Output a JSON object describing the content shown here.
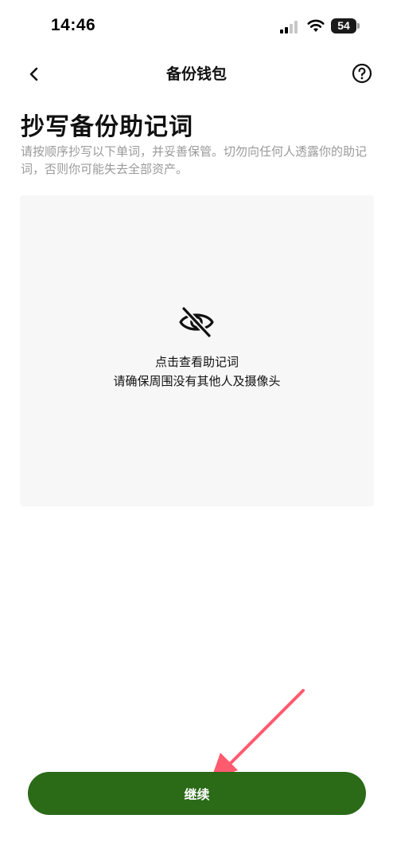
{
  "status_bar": {
    "time": "14:46",
    "battery": "54",
    "icons": [
      "signal-icon",
      "wifi-icon",
      "battery-icon"
    ]
  },
  "nav": {
    "title": "备份钱包",
    "back_icon": "chevron-left-icon",
    "help_icon": "question-circle-icon"
  },
  "content": {
    "title": "抄写备份助记词",
    "description": "请按顺序抄写以下单词，并妥善保管。切勿向任何人透露你的助记词，否则你可能失去全部资产。"
  },
  "reveal_panel": {
    "icon": "eye-off-icon",
    "title": "点击查看助记词",
    "subtitle": "请确保周围没有其他人及摄像头"
  },
  "footer": {
    "continue_label": "继续"
  },
  "colors": {
    "primary_button": "#2b6a17",
    "panel_background": "#f7f7f7",
    "description_text": "#9a9a9a",
    "annotation_arrow": "#ff5a6e"
  }
}
